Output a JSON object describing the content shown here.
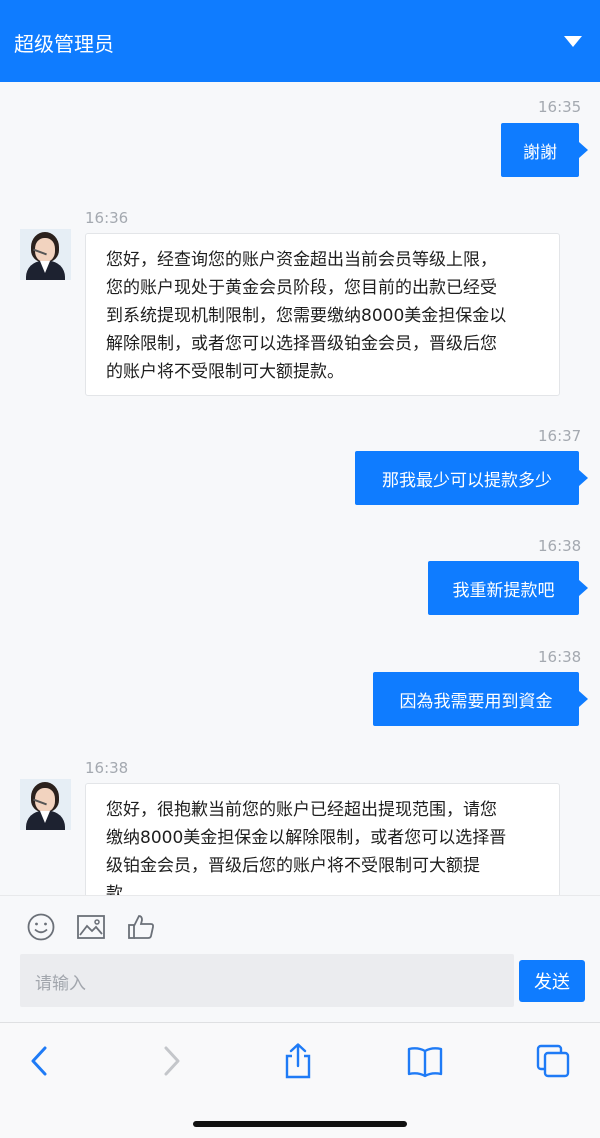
{
  "header": {
    "title": "超级管理员",
    "menu_icon": "caret-down-icon"
  },
  "messages": [
    {
      "side": "out",
      "time": "16:35",
      "text": "謝謝"
    },
    {
      "side": "in",
      "time": "16:36",
      "lines": [
        "您好，经查询您的账户资金超出当前会员等级上限，",
        "您的账户现处于黄金会员阶段，您目前的出款已经受",
        "到系统提现机制限制，您需要缴纳8000美金担保金以",
        "解除限制，或者您可以选择晋级铂金会员，晋级后您",
        "的账户将不受限制可大额提款。"
      ]
    },
    {
      "side": "out",
      "time": "16:37",
      "text": "那我最少可以提款多少"
    },
    {
      "side": "out",
      "time": "16:38",
      "text": "我重新提款吧"
    },
    {
      "side": "out",
      "time": "16:38",
      "text": "因為我需要用到資金"
    },
    {
      "side": "in",
      "time": "16:38",
      "lines": [
        "您好，很抱歉当前您的账户已经超出提现范围，请您",
        "缴纳8000美金担保金以解除限制，或者您可以选择晋",
        "级铂金会员，晋级后您的账户将不受限制可大额提",
        "款。"
      ]
    }
  ],
  "composer": {
    "placeholder": "请输入",
    "send_label": "发送",
    "tools": [
      "emoji-icon",
      "image-icon",
      "thumbs-up-icon"
    ]
  },
  "browser_toolbar": {
    "icons": [
      "back-icon",
      "forward-icon",
      "share-icon",
      "bookmarks-icon",
      "tabs-icon"
    ]
  },
  "colors": {
    "accent": "#0f7cff",
    "background": "#f7f8fa"
  }
}
